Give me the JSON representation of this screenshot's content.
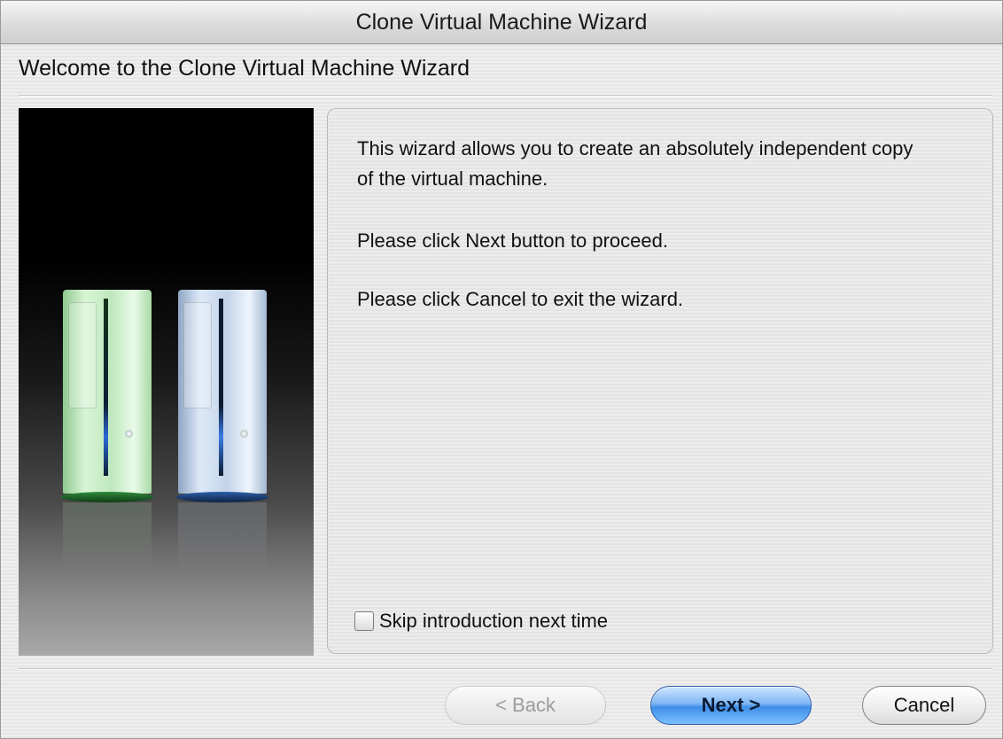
{
  "window": {
    "title": "Clone Virtual Machine Wizard"
  },
  "page": {
    "heading": "Welcome to the Clone Virtual Machine Wizard"
  },
  "content": {
    "paragraphs": [
      "This wizard allows you to create an absolutely independent copy of the virtual machine.",
      "Please click Next button to proceed.",
      "Please click Cancel to exit the wizard."
    ],
    "skip_checkbox": {
      "label": "Skip introduction next time",
      "checked": false
    }
  },
  "buttons": {
    "back": {
      "label": "< Back",
      "enabled": false
    },
    "next": {
      "label": "Next >",
      "default": true
    },
    "cancel": {
      "label": "Cancel"
    }
  },
  "illustration": {
    "icon": "two-computer-towers-illustration"
  },
  "colors": {
    "next_button": "#3f8fe8",
    "window_bg": "#ececec"
  }
}
